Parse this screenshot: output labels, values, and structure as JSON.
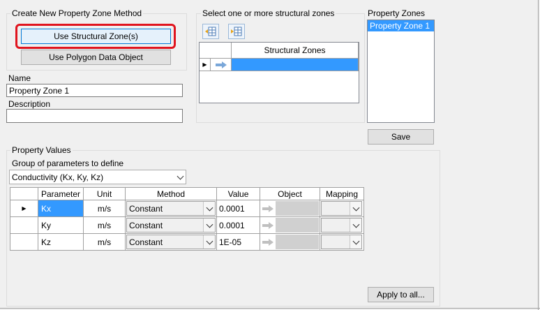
{
  "method_group": {
    "title": "Create New Property Zone Method",
    "use_structural_zones": "Use Structural Zone(s)",
    "use_polygon": "Use Polygon Data Object"
  },
  "name": {
    "label": "Name",
    "value": "Property Zone 1"
  },
  "description": {
    "label": "Description",
    "value": ""
  },
  "structural": {
    "title": "Select one or more structural zones",
    "column_header": "Structural Zones",
    "icons": [
      "add-rows-icon",
      "remove-rows-icon"
    ]
  },
  "property_zones": {
    "title": "Property Zones",
    "items": [
      "Property Zone 1"
    ],
    "save": "Save"
  },
  "property_values": {
    "title": "Property Values",
    "group_label": "Group of parameters to define",
    "group_selected": "Conductivity (Kx, Ky, Kz)",
    "columns": {
      "parameter": "Parameter",
      "unit": "Unit",
      "method": "Method",
      "value": "Value",
      "object": "Object",
      "mapping": "Mapping"
    },
    "rows": [
      {
        "parameter": "Kx",
        "unit": "m/s",
        "method": "Constant",
        "value": "0.0001"
      },
      {
        "parameter": "Ky",
        "unit": "m/s",
        "method": "Constant",
        "value": "0.0001"
      },
      {
        "parameter": "Kz",
        "unit": "m/s",
        "method": "Constant",
        "value": "1E-05"
      }
    ],
    "apply_all": "Apply to all..."
  },
  "colors": {
    "highlight": "#e0141e",
    "selection": "#3399ff"
  }
}
